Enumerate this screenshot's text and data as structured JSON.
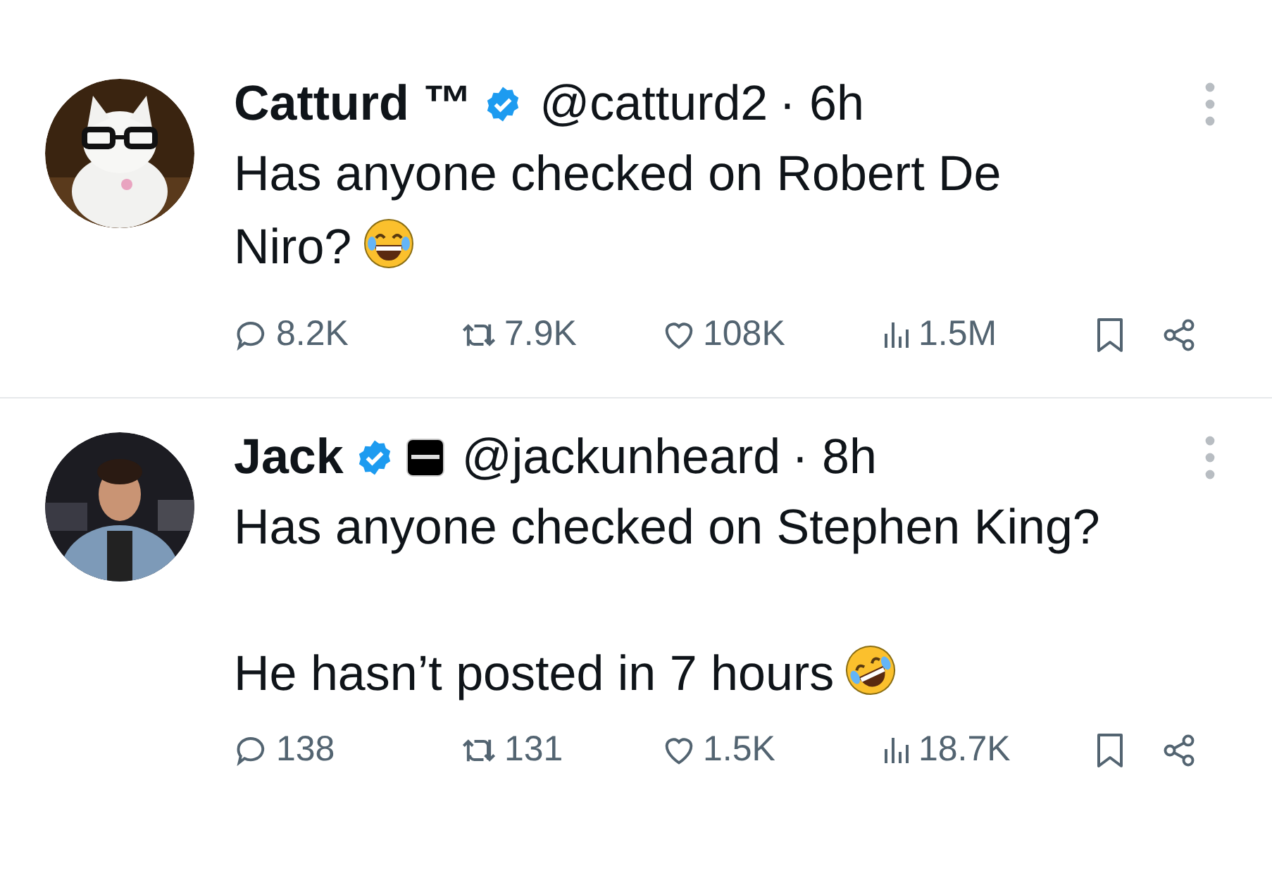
{
  "tweets": [
    {
      "name": "Catturd ™",
      "verified": true,
      "affiliate_badge": false,
      "handle": "@catturd2",
      "time": "· 6h",
      "avatar": {
        "kind": "picture"
      },
      "paragraphs": [
        "Has anyone checked on Robert De Niro?"
      ],
      "emoji": {
        "kind": "joy"
      },
      "stats": {
        "replies": "8.2K",
        "reposts": "7.9K",
        "likes": "108K",
        "views": "1.5M"
      }
    },
    {
      "name": "Jack",
      "verified": true,
      "affiliate_badge": true,
      "handle": "@jackunheard",
      "time": "· 8h",
      "avatar": {
        "kind": "picture"
      },
      "paragraphs": [
        "Has anyone checked on Stephen King?",
        "He hasn’t posted in 7 hours"
      ],
      "emoji": {
        "kind": "rofl"
      },
      "stats": {
        "replies": "138",
        "reposts": "131",
        "likes": "1.5K",
        "views": "18.7K"
      }
    }
  ]
}
